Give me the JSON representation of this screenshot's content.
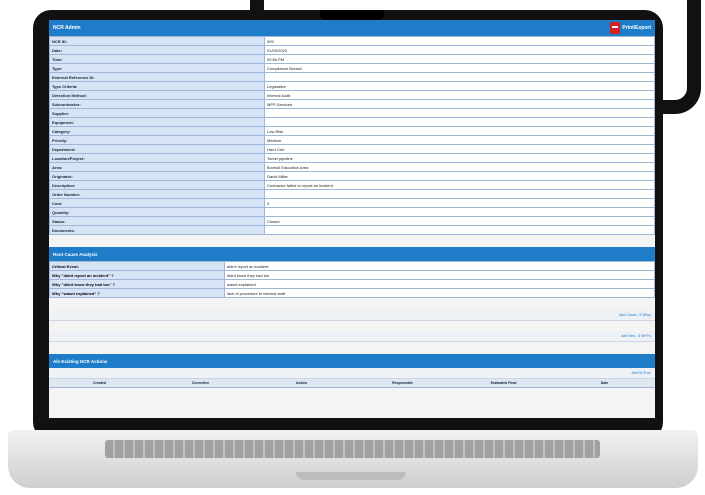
{
  "header": {
    "title": "NCR Admin",
    "print_export": "Print/Export",
    "accent": "#1f7cc9"
  },
  "details": [
    {
      "label": "NCR ID:",
      "value": "009"
    },
    {
      "label": "Date:",
      "value": "01/03/2023"
    },
    {
      "label": "Time:",
      "value": "02:56 PM"
    },
    {
      "label": "Type:",
      "value": "Compliance Breach"
    },
    {
      "label": "External Reference ID:",
      "value": ""
    },
    {
      "label": "Type Criteria:",
      "value": "Legislative"
    },
    {
      "label": "Detection Method:",
      "value": "Internal Audit"
    },
    {
      "label": "Subcontractor:",
      "value": "MPS Services"
    },
    {
      "label": "Supplier:",
      "value": ""
    },
    {
      "label": "Equipment:",
      "value": ""
    },
    {
      "label": "Category:",
      "value": "Low Risk"
    },
    {
      "label": "Priority:",
      "value": "Medium"
    },
    {
      "label": "Department:",
      "value": "Hard Civil"
    },
    {
      "label": "Location/Project:",
      "value": "Torbel pipeline"
    },
    {
      "label": "Area:",
      "value": "Boxhull Education Area"
    },
    {
      "label": "Originator:",
      "value": "David Miller"
    },
    {
      "label": "Description:",
      "value": "Contractor failed to report an incident"
    },
    {
      "label": "Order Number:",
      "value": ""
    },
    {
      "label": "Cost:",
      "value": "0"
    },
    {
      "label": "Quantity:",
      "value": ""
    },
    {
      "label": "Status:",
      "value": "Closed"
    },
    {
      "label": "Documents:",
      "value": ""
    }
  ],
  "root_cause": {
    "title": "Root Cause Analysis",
    "rows": [
      {
        "label": "Critical Event:",
        "value": "didn't report an incident"
      },
      {
        "label": "Why \"didnt report an incident\" ?",
        "value": "didnt know they had too"
      },
      {
        "label": "Why \"didnt know they had too\" ?",
        "value": "wasnt explained"
      },
      {
        "label": "Why \"wasnt explained\" ?",
        "value": "lack of procedure to internal staff"
      }
    ],
    "add_cause_link": "Add Cause / 5 Whys",
    "add_new_link": "Add New - 5 WHYs"
  },
  "actions": {
    "title": "Ale Existing NCR Actions",
    "add_link": "Add NCR Ac",
    "columns": [
      "Created",
      "Corrective",
      "Action",
      "Responsible",
      "Estimated Final",
      "Date"
    ]
  }
}
